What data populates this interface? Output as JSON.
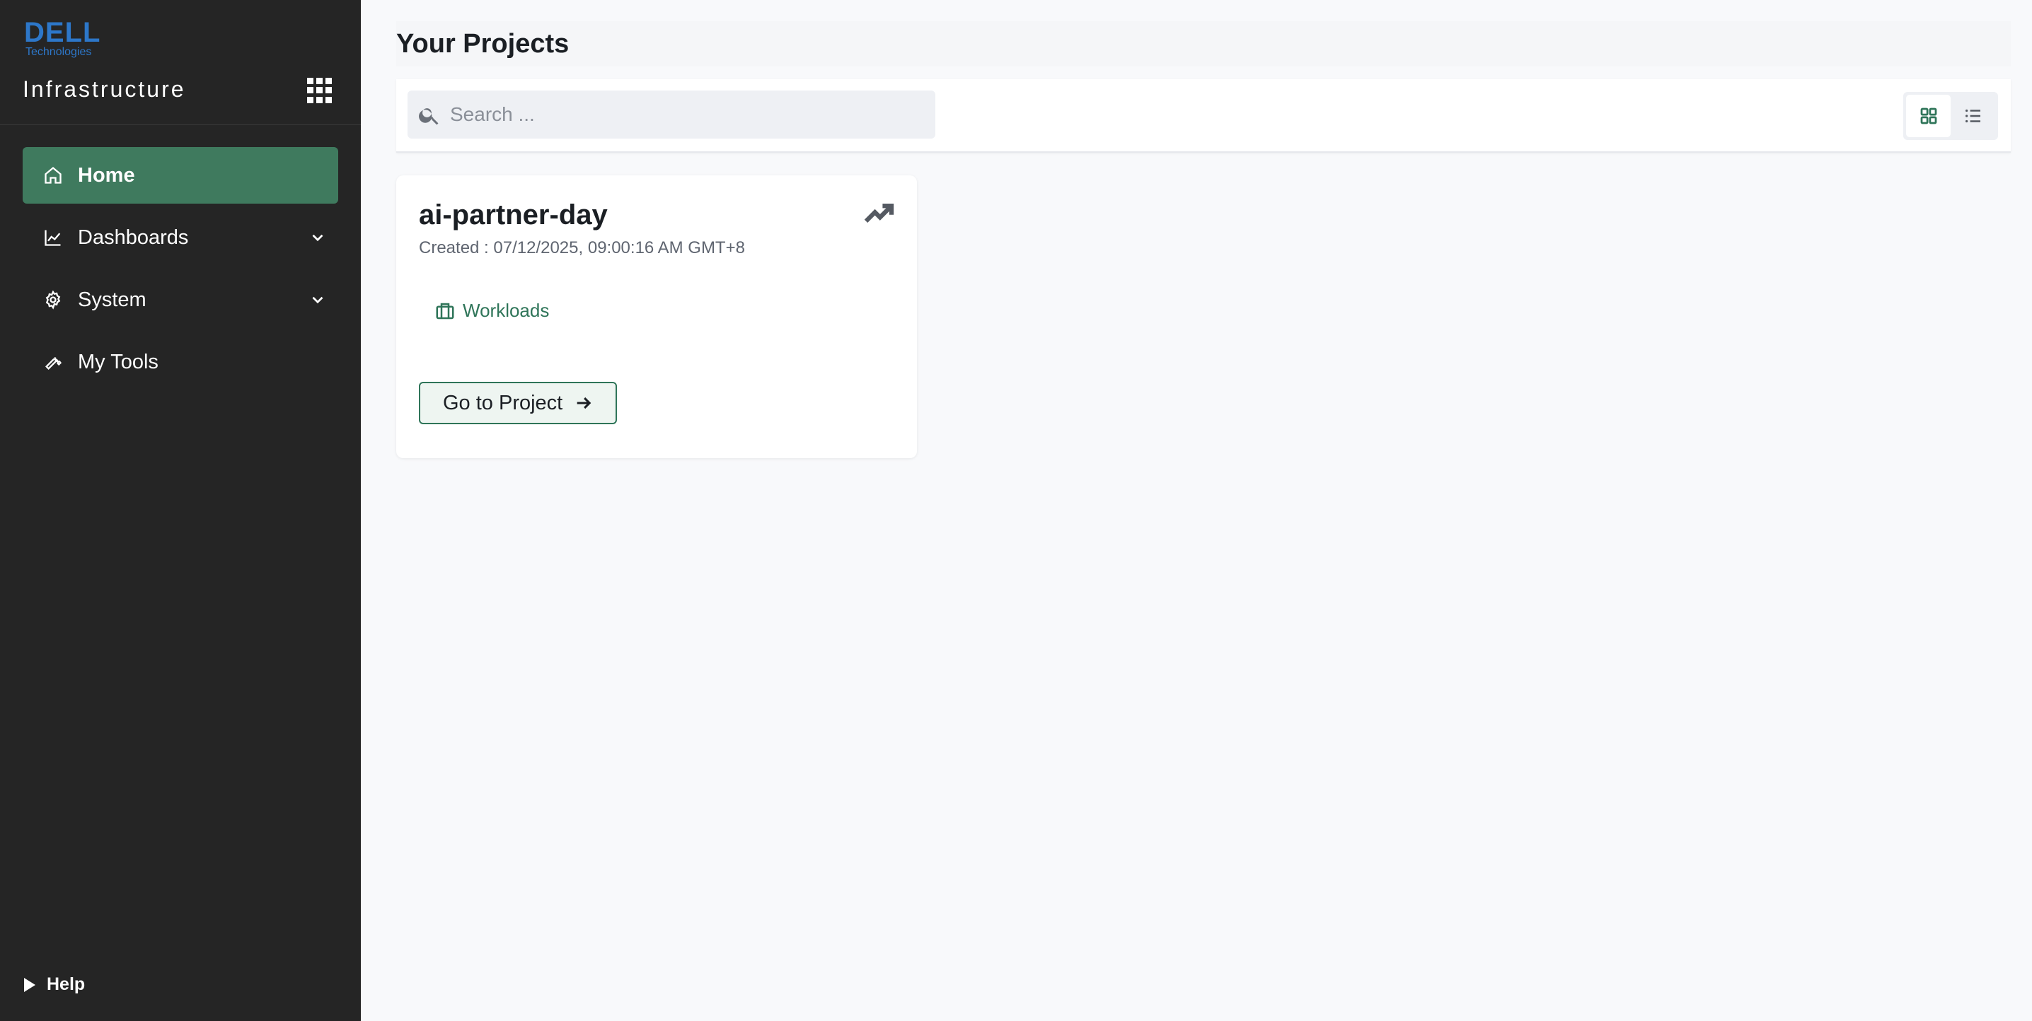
{
  "brand": {
    "logo_text": "DELL",
    "logo_subtext": "Technologies",
    "app_title": "Infrastructure",
    "apps_icon": "app-grid-icon",
    "logo_color": "#2d77c9"
  },
  "sidebar": {
    "items": [
      {
        "label": "Home",
        "icon": "home-icon",
        "active": true
      },
      {
        "label": "Dashboards",
        "icon": "chart-line-icon",
        "expandable": true
      },
      {
        "label": "System",
        "icon": "gear-icon",
        "expandable": true
      },
      {
        "label": "My Tools",
        "icon": "wrench-icon"
      }
    ],
    "help_label": "Help",
    "active_color": "#3f7a5e",
    "background": "#252525"
  },
  "main": {
    "title": "Your Projects",
    "search": {
      "placeholder": "Search ...",
      "value": ""
    },
    "view_toggle": {
      "selected": "grid",
      "options": [
        "grid-view-icon",
        "list-view-icon"
      ]
    }
  },
  "projects": [
    {
      "name": "ai-partner-day",
      "created": "Created : 07/12/2025, 09:00:16 AM GMT+8",
      "tag": "Workloads",
      "button_label": "Go to Project"
    }
  ],
  "colors": {
    "accent": "#2f7559"
  }
}
